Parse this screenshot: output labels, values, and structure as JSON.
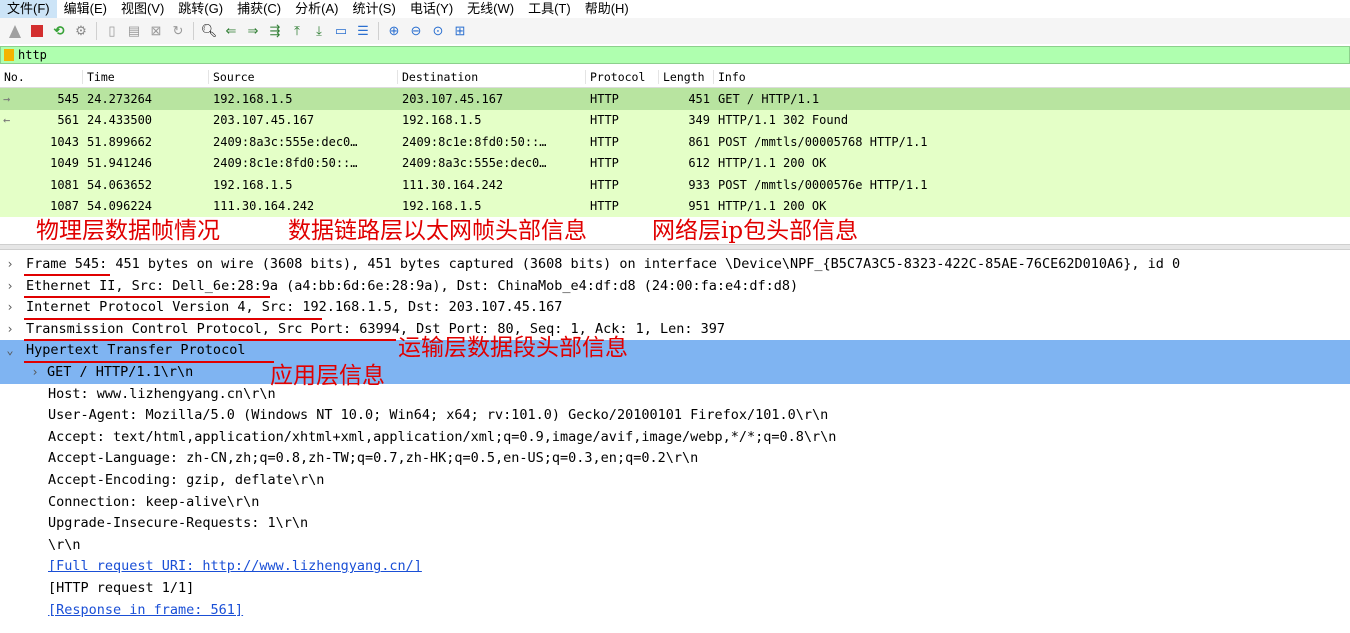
{
  "menu": [
    "文件(F)",
    "编辑(E)",
    "视图(V)",
    "跳转(G)",
    "捕获(C)",
    "分析(A)",
    "统计(S)",
    "电话(Y)",
    "无线(W)",
    "工具(T)",
    "帮助(H)"
  ],
  "filter": {
    "value": "http"
  },
  "packet_list": {
    "headers": {
      "no": "No.",
      "time": "Time",
      "source": "Source",
      "destination": "Destination",
      "protocol": "Protocol",
      "length": "Length",
      "info": "Info"
    },
    "rows": [
      {
        "no": "545",
        "time": "24.273264",
        "source": "192.168.1.5",
        "destination": "203.107.45.167",
        "protocol": "HTTP",
        "length": "451",
        "info": "GET / HTTP/1.1"
      },
      {
        "no": "561",
        "time": "24.433500",
        "source": "203.107.45.167",
        "destination": "192.168.1.5",
        "protocol": "HTTP",
        "length": "349",
        "info": "HTTP/1.1 302 Found"
      },
      {
        "no": "1043",
        "time": "51.899662",
        "source": "2409:8a3c:555e:dec0…",
        "destination": "2409:8c1e:8fd0:50::…",
        "protocol": "HTTP",
        "length": "861",
        "info": "POST /mmtls/00005768 HTTP/1.1"
      },
      {
        "no": "1049",
        "time": "51.941246",
        "source": "2409:8c1e:8fd0:50::…",
        "destination": "2409:8a3c:555e:dec0…",
        "protocol": "HTTP",
        "length": "612",
        "info": "HTTP/1.1 200 OK"
      },
      {
        "no": "1081",
        "time": "54.063652",
        "source": "192.168.1.5",
        "destination": "111.30.164.242",
        "protocol": "HTTP",
        "length": "933",
        "info": "POST /mmtls/0000576e HTTP/1.1"
      },
      {
        "no": "1087",
        "time": "54.096224",
        "source": "111.30.164.242",
        "destination": "192.168.1.5",
        "protocol": "HTTP",
        "length": "951",
        "info": "HTTP/1.1 200 OK"
      }
    ]
  },
  "annotations": {
    "physical": "物理层数据帧情况",
    "datalink": "数据链路层以太网帧头部信息",
    "network": "网络层ip包头部信息",
    "transport": "运输层数据段头部信息",
    "application": "应用层信息"
  },
  "details": {
    "frame": "Frame 545: 451 bytes on wire (3608 bits), 451 bytes captured (3608 bits) on interface \\Device\\NPF_{B5C7A3C5-8323-422C-85AE-76CE62D010A6}, id 0",
    "ethernet": "Ethernet II, Src: Dell_6e:28:9a (a4:bb:6d:6e:28:9a), Dst: ChinaMob_e4:df:d8 (24:00:fa:e4:df:d8)",
    "ip": "Internet Protocol Version 4, Src: 192.168.1.5, Dst: 203.107.45.167",
    "tcp": "Transmission Control Protocol, Src Port: 63994, Dst Port: 80, Seq: 1, Ack: 1, Len: 397",
    "http": "Hypertext Transfer Protocol",
    "http_lines": {
      "get": "GET / HTTP/1.1\\r\\n",
      "host": "Host: www.lizhengyang.cn\\r\\n",
      "user_agent": "User-Agent: Mozilla/5.0 (Windows NT 10.0; Win64; x64; rv:101.0) Gecko/20100101 Firefox/101.0\\r\\n",
      "accept": "Accept: text/html,application/xhtml+xml,application/xml;q=0.9,image/avif,image/webp,*/*;q=0.8\\r\\n",
      "accept_language": "Accept-Language: zh-CN,zh;q=0.8,zh-TW;q=0.7,zh-HK;q=0.5,en-US;q=0.3,en;q=0.2\\r\\n",
      "accept_encoding": "Accept-Encoding: gzip, deflate\\r\\n",
      "connection": "Connection: keep-alive\\r\\n",
      "upgrade": "Upgrade-Insecure-Requests: 1\\r\\n",
      "crlf": "\\r\\n",
      "full_uri": "[Full request URI: http://www.lizhengyang.cn/]",
      "request_count": "[HTTP request 1/1]",
      "response_in": "[Response in frame: 561]"
    }
  }
}
